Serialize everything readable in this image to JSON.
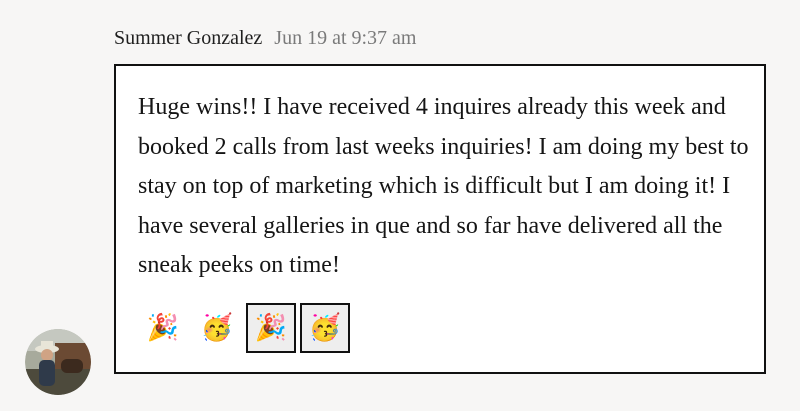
{
  "post": {
    "author": "Summer Gonzalez",
    "timestamp": "Jun 19 at 9:37 am",
    "message": "Huge wins!! I have received 4 inquires already this week and booked 2 calls from last weeks inquiries! I am doing my best to stay on top of marketing which is difficult but I am doing it! I have several galleries in que and so far have delivered all the sneak peeks on time!",
    "reactions": [
      {
        "emoji": "🎉",
        "icon_name": "party-popper-icon",
        "selected": false
      },
      {
        "emoji": "🥳",
        "icon_name": "partying-face-icon",
        "selected": false
      },
      {
        "emoji": "🎉",
        "icon_name": "party-popper-icon",
        "selected": true
      },
      {
        "emoji": "🥳",
        "icon_name": "partying-face-icon",
        "selected": true
      }
    ]
  },
  "colors": {
    "background": "#f7f6f5",
    "bubble_border": "#111111",
    "timestamp": "#7a7a7a"
  }
}
